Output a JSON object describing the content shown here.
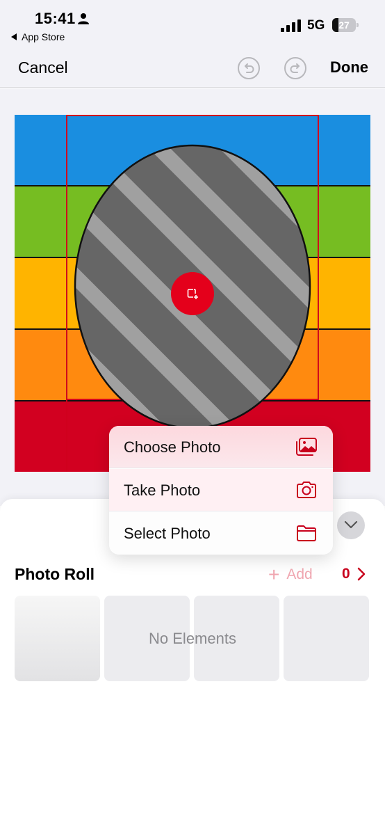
{
  "status_bar": {
    "time": "15:41",
    "back_app": "App Store",
    "network": "5G",
    "battery": "27",
    "battery_level_percent": 27
  },
  "nav": {
    "cancel": "Cancel",
    "done": "Done"
  },
  "canvas": {
    "stripe_colors": [
      "#1a8ee0",
      "#76bd22",
      "#ffb400",
      "#ff8a0f",
      "#d20020"
    ],
    "accent_color": "#e4001b"
  },
  "menu": {
    "items": [
      {
        "label": "Choose Photo",
        "icon": "photo-library-icon"
      },
      {
        "label": "Take Photo",
        "icon": "camera-icon"
      },
      {
        "label": "Select Photo",
        "icon": "folder-icon"
      }
    ]
  },
  "photo_roll": {
    "title": "Photo Roll",
    "add": "Add",
    "count": "0",
    "empty_text": "No Elements"
  }
}
